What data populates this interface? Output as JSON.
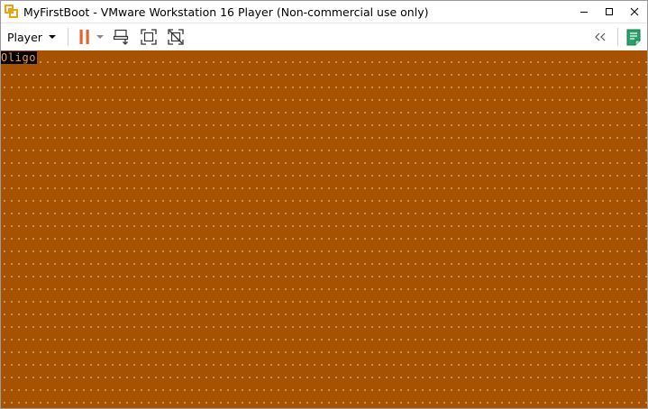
{
  "window": {
    "title": "MyFirstBoot - VMware Workstation 16 Player (Non-commercial use only)",
    "icon": "vmware-player-icon"
  },
  "window_controls": {
    "minimize_icon": "minimize-icon",
    "maximize_icon": "maximize-icon",
    "close_icon": "close-icon"
  },
  "toolbar": {
    "player_menu_label": "Player",
    "pause_icon": "pause-icon",
    "send_ctrl_alt_del_icon": "send-ctrl-alt-del-icon",
    "fullscreen_icon": "fullscreen-icon",
    "unity_icon": "unity-icon",
    "collapse_icon": "double-chevron-left-icon",
    "notes_icon": "notes-icon"
  },
  "colors": {
    "screen_background": "#a65200",
    "screen_dots": "#e8c9a0",
    "pause_accent": "#e8622a",
    "notes_accent": "#2aa06a",
    "boot_text_fg": "#f0a040",
    "boot_text_bg": "#000000"
  },
  "vm_screen": {
    "boot_text": "Oligo"
  }
}
